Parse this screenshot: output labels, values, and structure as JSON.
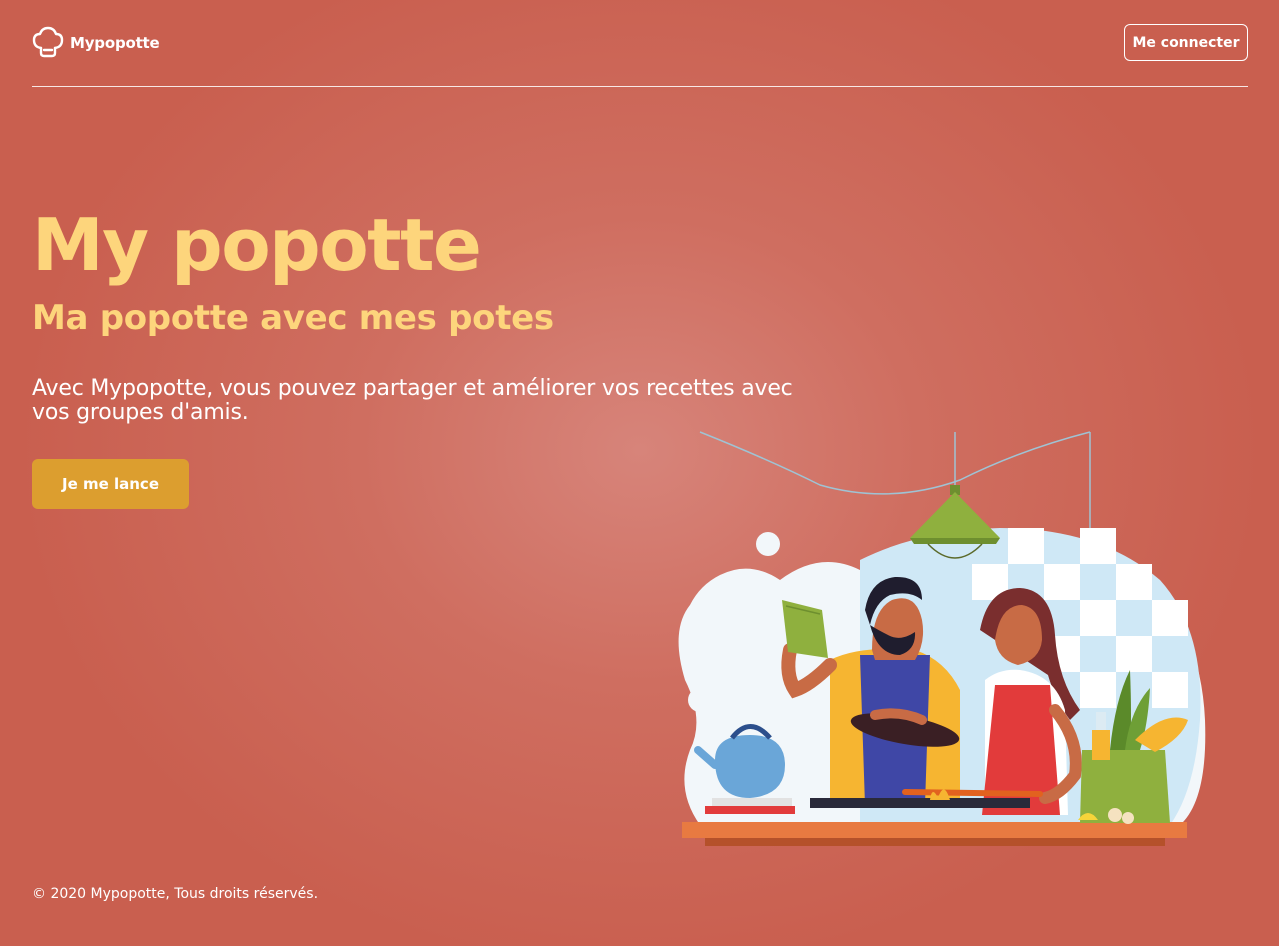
{
  "header": {
    "logo_text": "Mypopotte",
    "logo_icon": "chef-hat-icon",
    "login_label": "Me connecter"
  },
  "hero": {
    "title": "My popotte",
    "subtitle": "Ma popotte avec mes potes",
    "description": "Avec Mypopotte, vous pouvez partager et améliorer vos recettes avec vos groupes d'amis.",
    "cta_label": "Je me lance",
    "illustration": "cooking-couple-illustration"
  },
  "footer": {
    "copyright": "© 2020 Mypopotte, Tous droits réservés."
  },
  "colors": {
    "background": "#cf6e60",
    "accent_yellow": "#fdd57c",
    "cta": "#dc9e2f",
    "text": "#ffffff"
  }
}
